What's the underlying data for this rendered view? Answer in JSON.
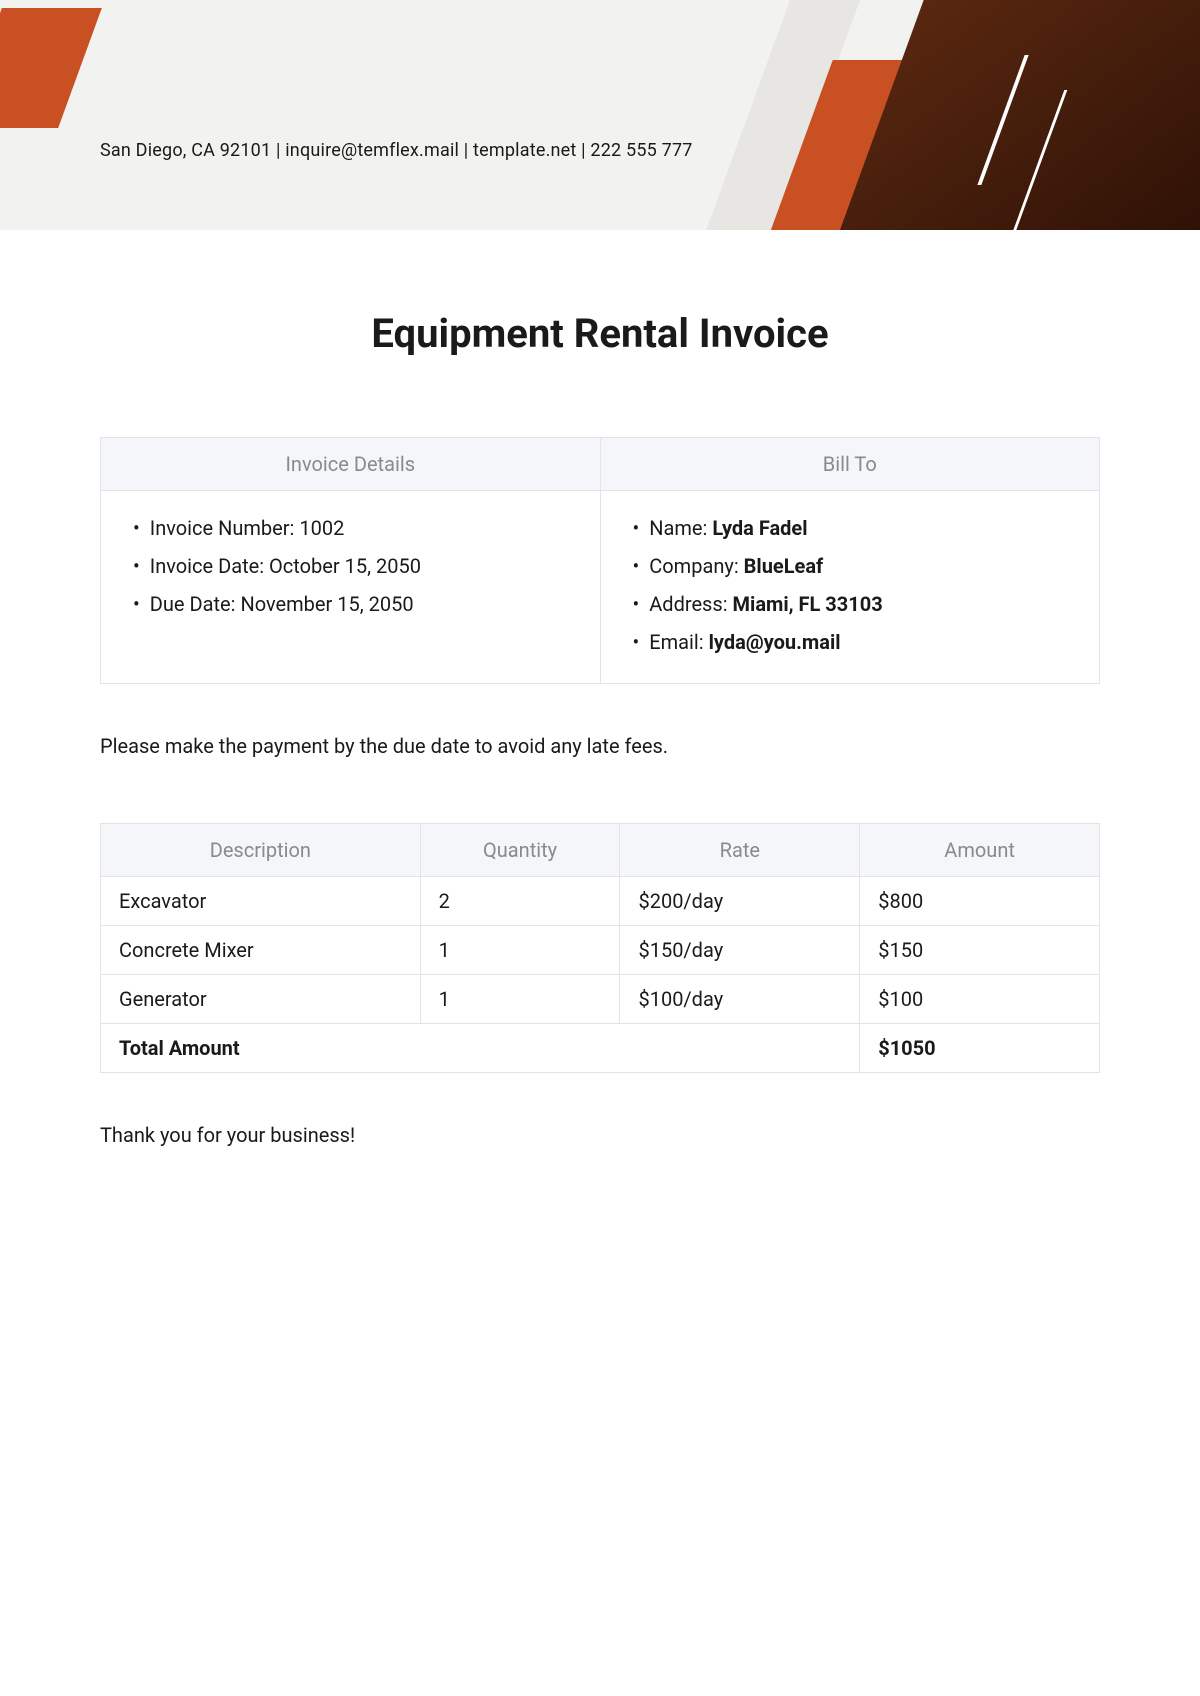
{
  "header": {
    "contact": "San Diego, CA 92101 | inquire@temflex.mail | template.net | 222 555 777"
  },
  "title": "Equipment Rental Invoice",
  "details": {
    "headers": [
      "Invoice Details",
      "Bill To"
    ],
    "invoice": {
      "number_label": "Invoice Number: ",
      "number_value": "1002",
      "date_label": "Invoice Date: ",
      "date_value": "October 15, 2050",
      "due_label": "Due Date: ",
      "due_value": "November 15, 2050"
    },
    "billto": {
      "name_label": "Name: ",
      "name_value": "Lyda Fadel",
      "company_label": "Company: ",
      "company_value": "BlueLeaf",
      "address_label": "Address: ",
      "address_value": "Miami, FL 33103",
      "email_label": "Email: ",
      "email_value": "lyda@you.mail"
    }
  },
  "note": "Please make the payment by the due date to avoid any late fees.",
  "items": {
    "headers": [
      "Description",
      "Quantity",
      "Rate",
      "Amount"
    ],
    "rows": [
      {
        "desc": "Excavator",
        "qty": "2",
        "rate": "$200/day",
        "amount": "$800"
      },
      {
        "desc": "Concrete Mixer",
        "qty": "1",
        "rate": "$150/day",
        "amount": "$150"
      },
      {
        "desc": "Generator",
        "qty": "1",
        "rate": "$100/day",
        "amount": "$100"
      }
    ],
    "total_label": "Total Amount",
    "total_value": "$1050"
  },
  "thanks": "Thank you for your business!"
}
